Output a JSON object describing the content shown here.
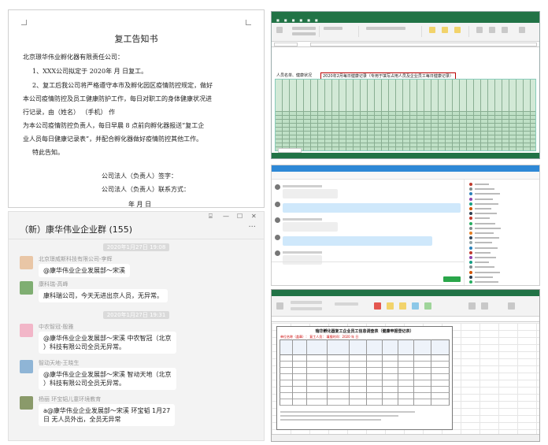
{
  "notice": {
    "title": "复工告知书",
    "addressee": "北京璟华伟业孵化器有限责任公司：",
    "item1": "1、XXX公司拟定于 2020年     月      日复工。",
    "item2_l1": "2、复工后我公司将严格遵守本市及孵化园区疫情防控规定，做好",
    "item2_l2": "本公司疫情防控及员工健康防护工作，每日对职工的身体健康状况进",
    "item2_l3": "行记录，由（姓名）                    （手机）                              作",
    "item2_l4": "为本公司疫情防控负责人，每日早晨 8 点前向孵化器报送“复工企",
    "item2_l5": "业人员每日健康记录表”，并配合孵化器做好疫情防控其他工作。",
    "closing": "特此告知。",
    "legal_rep": "公司法人（负责人）签字：",
    "contact": "公司法人（负责人）联系方式：",
    "date": "年       月       日"
  },
  "excel_log": {
    "header_left": "人员名单、健康状况",
    "header_title": "2020年2月每日健康记录（专用于填写占用人员及企业员工每日健康记录）"
  },
  "group_chat": {
    "title": "（新）康华伟业企业群 (155)",
    "more_label": "···",
    "window_controls": [
      "⌸",
      "—",
      "☐",
      "✕"
    ],
    "messages": [
      {
        "time": "2020年1月27日 19:08",
        "sender": "北京璟威斯科技有限公司-李辉",
        "text": "@康华伟业企业发展部～宋溪",
        "avatar_color": "#e9c6a6"
      },
      {
        "time": "",
        "sender": "康科瑞-高峰",
        "text": "康科瑞公司，今天无进出京人员，无异常。",
        "avatar_color": "#7fae72"
      },
      {
        "time": "2020年1月27日 19:31",
        "sender": "中农智冠-殷雅",
        "text_l1": "@康华伟业企业发展部～宋溪 中农智冠（北京",
        "text_l2": "）科技有限公司全员无异常。",
        "avatar_color": "#f2b6c8"
      },
      {
        "time": "",
        "sender": "智动天地-王晓生",
        "text_l1": "@康华伟业企业发展部～宋溪 智动天地（北京",
        "text_l2": "）科技有限公司全员无异常。",
        "avatar_color": "#8fb5d6"
      },
      {
        "time": "",
        "sender": "杨丽 环宝韬儿童环境教育",
        "text_l1": "a@康华伟业企业发展部～宋溪 环宝韬 1月27",
        "text_l2": "日 无人员外出，全员无异常",
        "avatar_color": "#8a9a6a"
      }
    ]
  },
  "form": {
    "title": "瑞华孵化器复工企业员工信息调查表（健康申报登记表）",
    "subtitle": "单位名称（盖章）：                                    复工人员：     填报时间：2020 年     日"
  },
  "colors": {
    "excel_green": "#217346",
    "excel_grid": "#bfe0c6",
    "chat_blue": "#2e88d6",
    "send_green": "#2aa64a"
  }
}
